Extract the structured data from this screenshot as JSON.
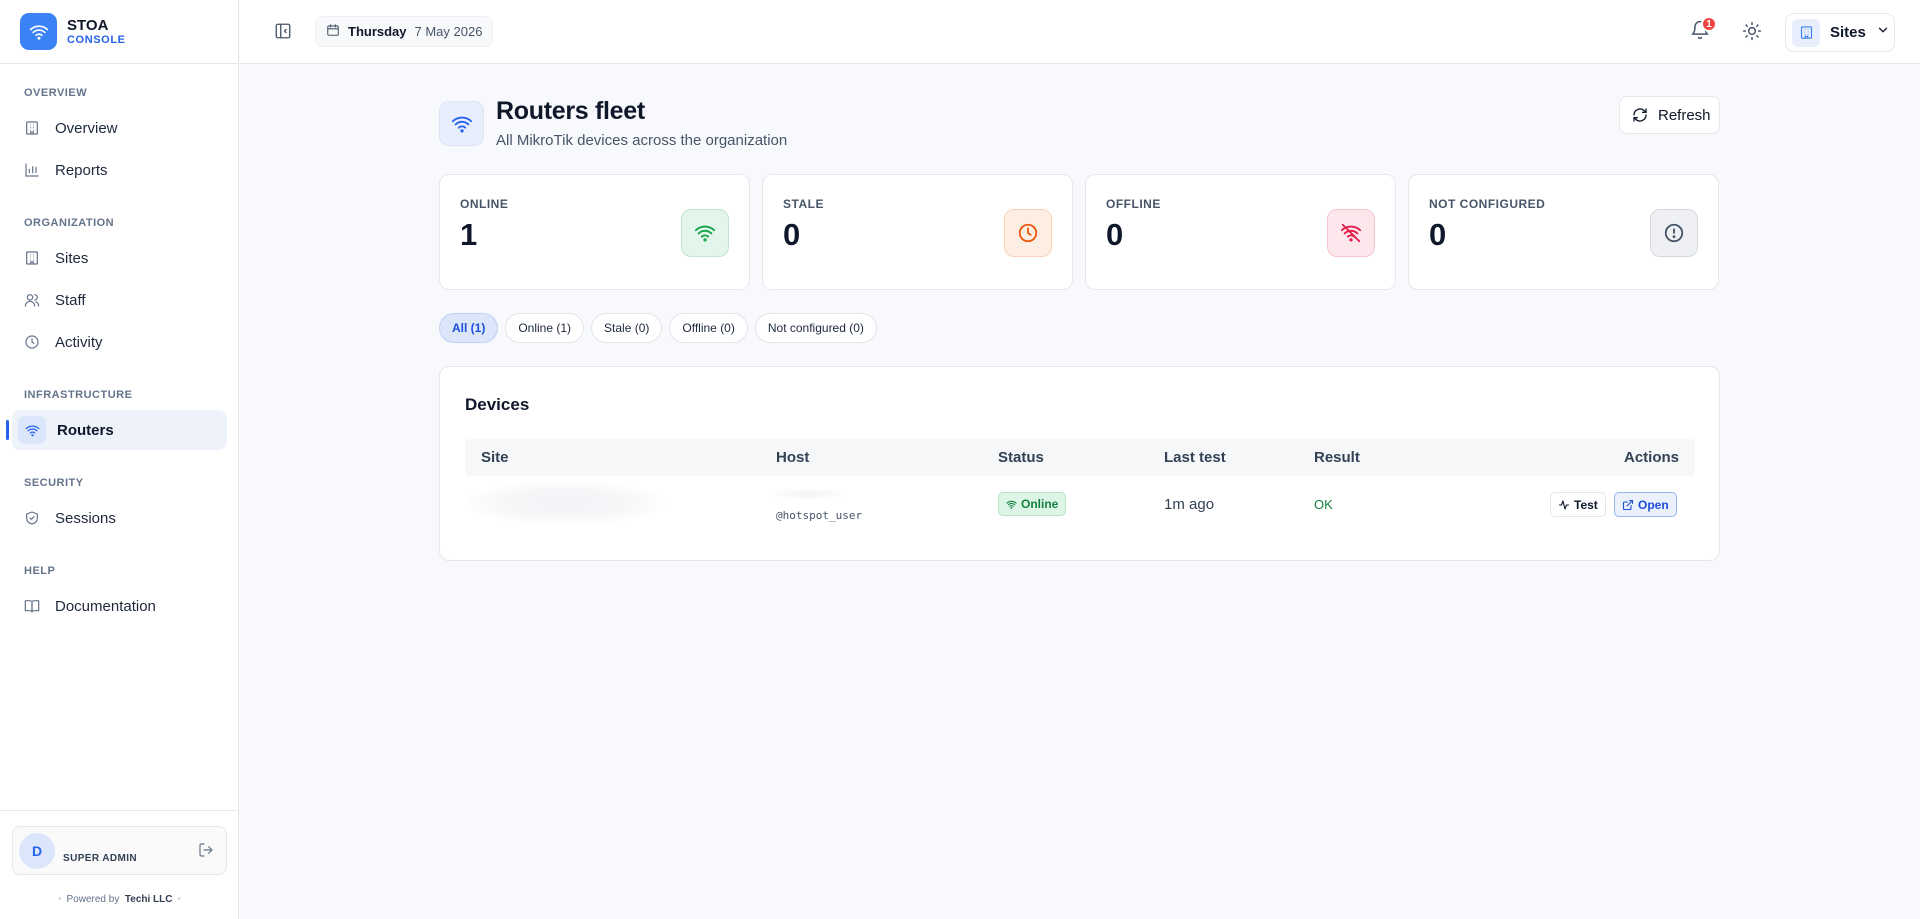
{
  "brand": {
    "name": "STOA",
    "sub": "CONSOLE"
  },
  "nav": {
    "overview_heading": "OVERVIEW",
    "overview": "Overview",
    "reports": "Reports",
    "organization_heading": "ORGANIZATION",
    "sites": "Sites",
    "staff": "Staff",
    "activity": "Activity",
    "infrastructure_heading": "INFRASTRUCTURE",
    "routers": "Routers",
    "security_heading": "SECURITY",
    "sessions": "Sessions",
    "help_heading": "HELP",
    "documentation": "Documentation"
  },
  "user": {
    "initial": "D",
    "role": "SUPER ADMIN"
  },
  "footer": {
    "powered_by": "Powered by",
    "company": "Techi LLC"
  },
  "topbar": {
    "day": "Thursday",
    "date": "7 May 2026",
    "notification_count": "1",
    "sites_label": "Sites"
  },
  "page": {
    "title": "Routers fleet",
    "subtitle": "All MikroTik devices across the organization",
    "refresh_label": "Refresh"
  },
  "stats": [
    {
      "label": "ONLINE",
      "value": "1",
      "color": "#16a34a",
      "bg": "#e3f6ec",
      "border": "#bfe8d0",
      "icon": "wifi-icon"
    },
    {
      "label": "STALE",
      "value": "0",
      "color": "#ea580c",
      "bg": "#fdeee4",
      "border": "#f8d2b8",
      "icon": "clock-icon"
    },
    {
      "label": "OFFLINE",
      "value": "0",
      "color": "#e11d48",
      "bg": "#fde7ec",
      "border": "#f6c4cf",
      "icon": "wifi-off-icon"
    },
    {
      "label": "NOT CONFIGURED",
      "value": "0",
      "color": "#475569",
      "bg": "#eef0f3",
      "border": "#d5d9df",
      "icon": "alert-circle-icon"
    }
  ],
  "filters": [
    "All (1)",
    "Online (1)",
    "Stale (0)",
    "Offline (0)",
    "Not configured (0)"
  ],
  "devices": {
    "title": "Devices",
    "columns": {
      "site": "Site",
      "host": "Host",
      "status": "Status",
      "last_test": "Last test",
      "result": "Result",
      "actions": "Actions"
    },
    "rows": [
      {
        "site": "",
        "host": "@hotspot_user",
        "status": "Online",
        "last_test": "1m ago",
        "result": "OK",
        "test_label": "Test",
        "open_label": "Open"
      }
    ]
  }
}
